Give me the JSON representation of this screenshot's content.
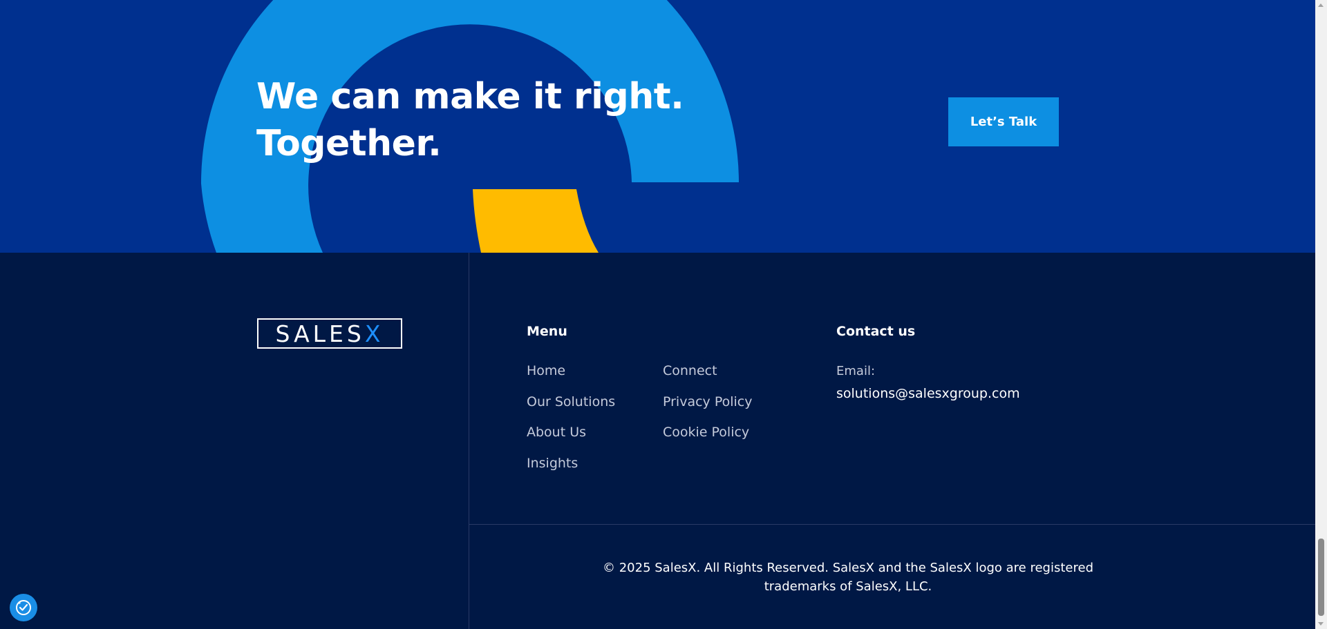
{
  "cta": {
    "title_line1": "We can make it right.",
    "title_line2": "Together.",
    "button_label": "Let’s Talk"
  },
  "footer": {
    "logo_text": "SALES",
    "logo_accent": "X",
    "menu_heading": "Menu",
    "menu_column1": [
      "Home",
      "Our Solutions",
      "About Us",
      "Insights"
    ],
    "menu_column2": [
      "Connect",
      "Privacy Policy",
      "Cookie Policy"
    ],
    "contact_heading": "Contact us",
    "contact_label": "Email:",
    "contact_email": "solutions@salesxgroup.com",
    "copyright_line1": "© 2025 SalesX. All Rights Reserved. SalesX and the SalesX logo are registered",
    "copyright_line2": "trademarks of SalesX, LLC."
  },
  "widgets": {
    "accessibility_icon": "accessibility-icon"
  },
  "colors": {
    "band_background": "#00308f",
    "footer_background": "#001845",
    "accent_blue": "#0d8fe2",
    "accent_yellow": "#ffbb00"
  }
}
